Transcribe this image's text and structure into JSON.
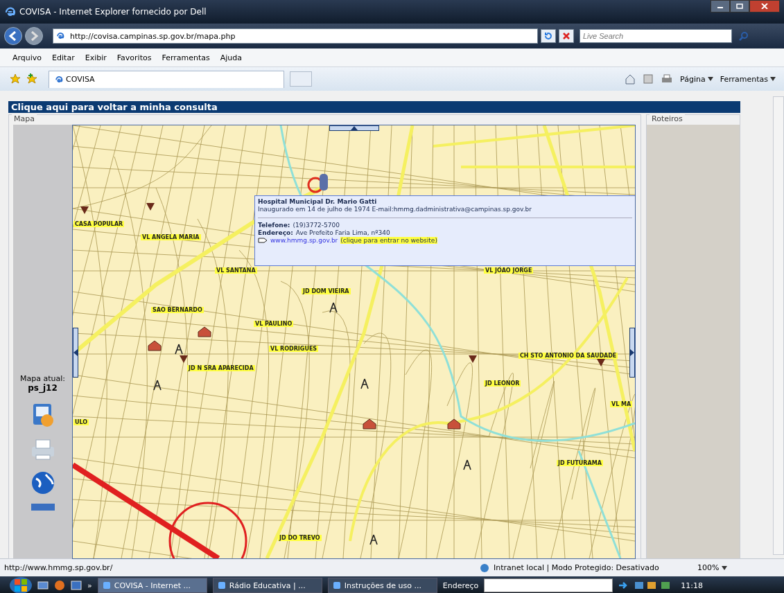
{
  "window": {
    "title": "COVISA - Internet Explorer fornecido por Dell"
  },
  "address_bar": {
    "url": "http://covisa.campinas.sp.gov.br/mapa.php",
    "search_placeholder": "Live Search"
  },
  "menu": [
    "Arquivo",
    "Editar",
    "Exibir",
    "Favoritos",
    "Ferramentas",
    "Ajuda"
  ],
  "tabs": [
    {
      "label": "COVISA",
      "selected": true
    }
  ],
  "command_bar": [
    "Página",
    "Ferramentas"
  ],
  "page": {
    "header_link": "Clique aqui para voltar a minha consulta",
    "map_panel": {
      "legend": "Mapa",
      "current_map_label": "Mapa atual:",
      "current_map": "ps_j12",
      "labels": [
        "CASA POPULAR",
        "VL ANGELA MARIA",
        "VL SANTANA",
        "VL JOAO JORGE",
        "SAO BERNARDO",
        "JD DOM VIEIRA",
        "VL PAULINO",
        "VL RODRIGUES",
        "JD N SRA APARECIDA",
        "CH STO ANTONIO DA SAUDADE",
        "JD LEONOR",
        "VL MA",
        "ULO",
        "JD FUTURAMA",
        "JD DO TREVO"
      ],
      "popup": {
        "title": "Hospital Municipal Dr. Mario Gatti",
        "description": "Inaugurado em 14 de julho de 1974 E-mail:hmmg.dadministrativa@campinas.sp.gov.br",
        "phone_label": "Telefone:",
        "phone": "(19)3772-5700",
        "address_label": "Endereço:",
        "address": "Ave Prefeito Faria Lima, nº340",
        "website": "www.hmmg.sp.gov.br",
        "website_hint": "(clique para entrar no website)"
      }
    },
    "routes_panel": {
      "legend": "Roteiros"
    }
  },
  "status_bar": {
    "url": "http://www.hmmg.sp.gov.br/",
    "zone": "Intranet local | Modo Protegido: Desativado",
    "zoom": "100%"
  },
  "taskbar": {
    "overflow": "»",
    "tasks": [
      {
        "label": "COVISA - Internet ...",
        "selected": true
      },
      {
        "label": "Rádio Educativa | ...",
        "selected": false
      },
      {
        "label": "Instruções de uso ...",
        "selected": false
      }
    ],
    "address_label": "Endereço",
    "time": "11:18"
  }
}
